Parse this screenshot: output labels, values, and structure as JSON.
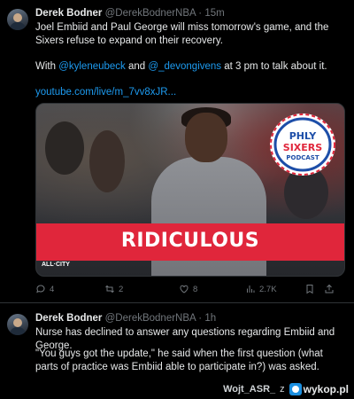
{
  "tweet1": {
    "author_name": "Derek Bodner",
    "handle": "@DerekBodnerNBA",
    "separator": "·",
    "time": "15m",
    "text_line1": "Joel Embiid and Paul George will miss tomorrow's game, and the Sixers refuse to expand on their recovery.",
    "text2_prefix": "With ",
    "mention1": "@kyleneubeck",
    "text2_middle": " and ",
    "mention2": "@_devongivens",
    "text2_suffix": " at 3 pm to talk about it.",
    "url": "youtube.com/live/m_7vv8xJR...",
    "media": {
      "banner_text": "RIDICULOUS",
      "logo_line1": "PHLY",
      "logo_line2": "SIXERS",
      "logo_line3": "PODCAST",
      "corner_brand": "ALL·CITY"
    },
    "actions": {
      "replies": "4",
      "reposts": "2",
      "likes": "8",
      "views": "2.7K"
    }
  },
  "tweet2": {
    "author_name": "Derek Bodner",
    "handle": "@DerekBodnerNBA",
    "separator": "·",
    "time": "1h",
    "text_line1": "Nurse has declined to answer any questions regarding Embiid and George.",
    "text_line2": "\"You guys got the update,\" he said when the first question (what parts of practice was Embiid able to participate in?) was asked."
  },
  "watermark": {
    "user": "Wojt_ASR_",
    "z": "z",
    "site": "wykop.pl"
  },
  "colors": {
    "background": "#000000",
    "text": "#e7e9ea",
    "muted": "#71767b",
    "link": "#1d9bf0",
    "banner": "#e0263b",
    "divider": "#2f3336"
  }
}
